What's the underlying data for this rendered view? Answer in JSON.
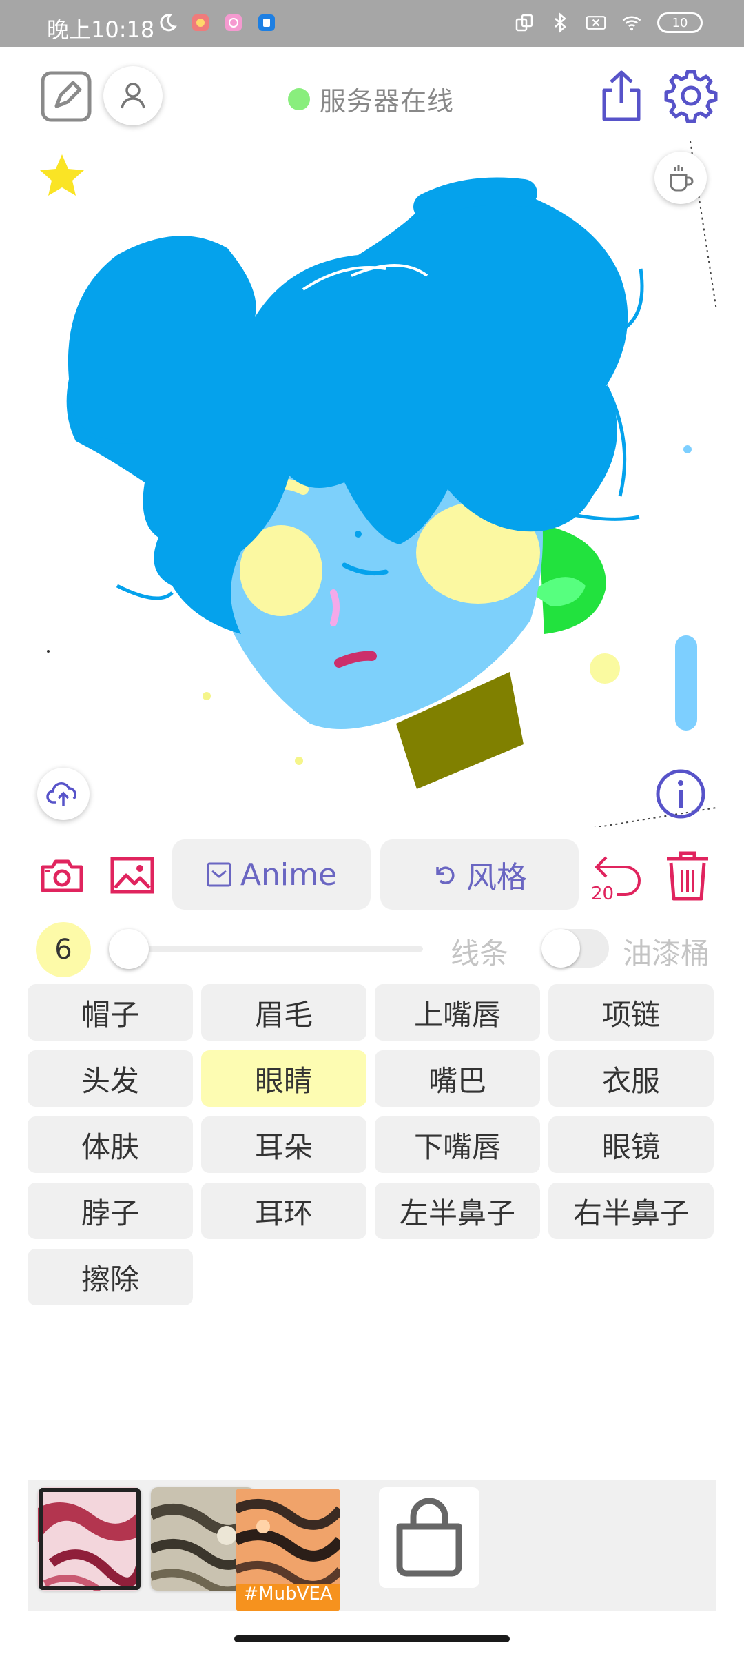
{
  "status_bar": {
    "time": "晚上10:18",
    "battery": "10"
  },
  "header": {
    "server_status": "服务器在线"
  },
  "colors": {
    "accent_purple": "#5753c9",
    "accent_red": "#e0245e",
    "server_online": "#89ee7d",
    "selected_part": "#fdfcb2"
  },
  "tools": {
    "style_button_label": "Anime",
    "restyle_button_label": "风格",
    "undo_count": "20"
  },
  "brush": {
    "size": "6",
    "line_label": "线条",
    "bucket_label": "油漆桶"
  },
  "parts": {
    "items": [
      {
        "label": "帽子"
      },
      {
        "label": "眉毛"
      },
      {
        "label": "上嘴唇"
      },
      {
        "label": "项链"
      },
      {
        "label": "头发"
      },
      {
        "label": "眼睛"
      },
      {
        "label": "嘴巴"
      },
      {
        "label": "衣服"
      },
      {
        "label": "体肤"
      },
      {
        "label": "耳朵"
      },
      {
        "label": "下嘴唇"
      },
      {
        "label": "眼镜"
      },
      {
        "label": "脖子"
      },
      {
        "label": "耳环"
      },
      {
        "label": "左半鼻子"
      },
      {
        "label": "右半鼻子"
      },
      {
        "label": "擦除"
      }
    ],
    "selected": "眼睛"
  },
  "style_tray": {
    "selected_tag": "#MubVEA"
  },
  "icons": {
    "status": [
      "moon-icon",
      "app-notification-icon",
      "bluetooth-icon",
      "wifi-icon",
      "battery-icon"
    ],
    "toolbar": [
      "draw-edit-icon",
      "user-icon",
      "share-icon",
      "settings-gear-icon"
    ],
    "canvas": [
      "star-icon",
      "coffee-cup-icon",
      "upload-cloud-icon",
      "info-icon"
    ],
    "tools": [
      "camera-icon",
      "image-icon",
      "undo-icon",
      "trash-icon"
    ],
    "tray": [
      "shopping-bag-icon"
    ]
  }
}
